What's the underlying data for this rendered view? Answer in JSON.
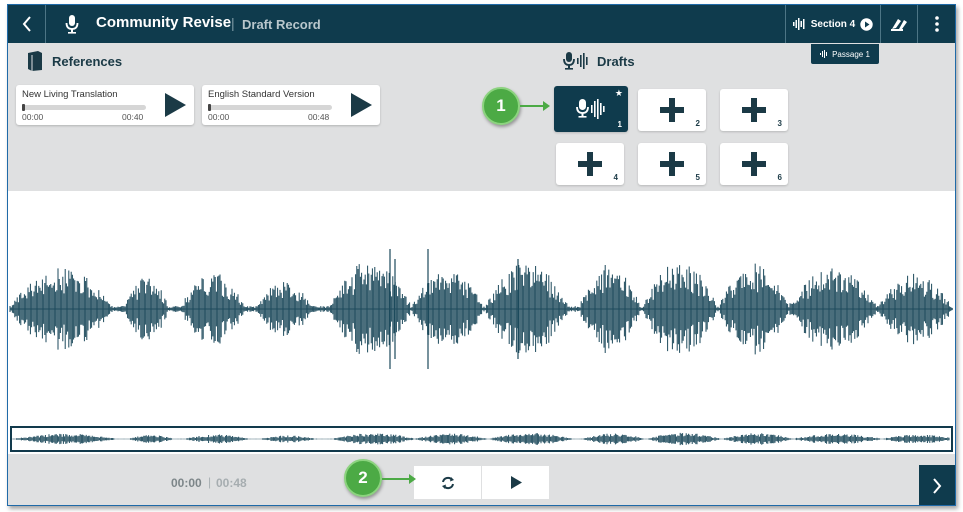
{
  "header": {
    "title": "Community Revise",
    "separator": "|",
    "subtitle": "Draft Record",
    "section_label": "Section 4",
    "passage_label": "Passage 1"
  },
  "references": {
    "heading": "References",
    "items": [
      {
        "name": "New Living Translation",
        "current": "00:00",
        "total": "00:40"
      },
      {
        "name": "English Standard Version",
        "current": "00:00",
        "total": "00:48"
      }
    ]
  },
  "drafts": {
    "heading": "Drafts",
    "slots": [
      {
        "number": "1",
        "state": "recorded",
        "starred": true
      },
      {
        "number": "2",
        "state": "empty"
      },
      {
        "number": "3",
        "state": "empty"
      },
      {
        "number": "4",
        "state": "empty"
      },
      {
        "number": "5",
        "state": "empty"
      },
      {
        "number": "6",
        "state": "empty"
      }
    ]
  },
  "callouts": [
    "1",
    "2"
  ],
  "playback": {
    "current": "00:00",
    "separator": "|",
    "total": "00:48"
  },
  "colors": {
    "brand_dark": "#0f3b4d",
    "panel_grey": "#dfe0e1",
    "callout_green": "#4caa45",
    "waveform": "#1d4a5c"
  },
  "icons": {
    "back": "chevron-left-icon",
    "microphone": "microphone-icon",
    "section": "waveform-icon",
    "tool": "pencil-hands-icon",
    "more": "more-vertical-icon",
    "book": "book-icon",
    "play": "play-icon",
    "add": "plus-icon",
    "loop": "loop-icon",
    "next": "chevron-right-icon"
  }
}
